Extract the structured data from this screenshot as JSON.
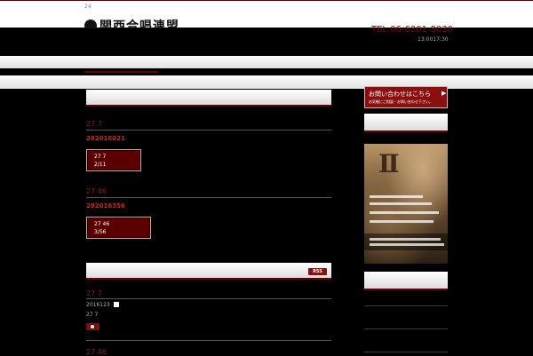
{
  "header": {
    "top_number": "24",
    "tel": "TEL.06-6201-8030",
    "hours": "13:0017:30"
  },
  "posts": [
    {
      "date": "27 7",
      "title": "282016021",
      "box_line1": "27 7",
      "box_line2": "2/11"
    },
    {
      "date": "27 46",
      "title": "282016356",
      "box_line1": "27 46",
      "box_line2": "3/56"
    }
  ],
  "news": {
    "rss_label": "RSS",
    "items": [
      {
        "date": "27 7",
        "meta": "2016123",
        "summary": "27 7"
      },
      {
        "date": "27 46"
      }
    ]
  },
  "sidebar": {
    "contact_title": "お問い合わせはこちら",
    "contact_sub": "お気軽にご相談・お問い合わせ下さい。"
  },
  "colors": {
    "accent": "#6b0000",
    "box_bg": "#5a0000",
    "title_red": "#cc2222"
  }
}
